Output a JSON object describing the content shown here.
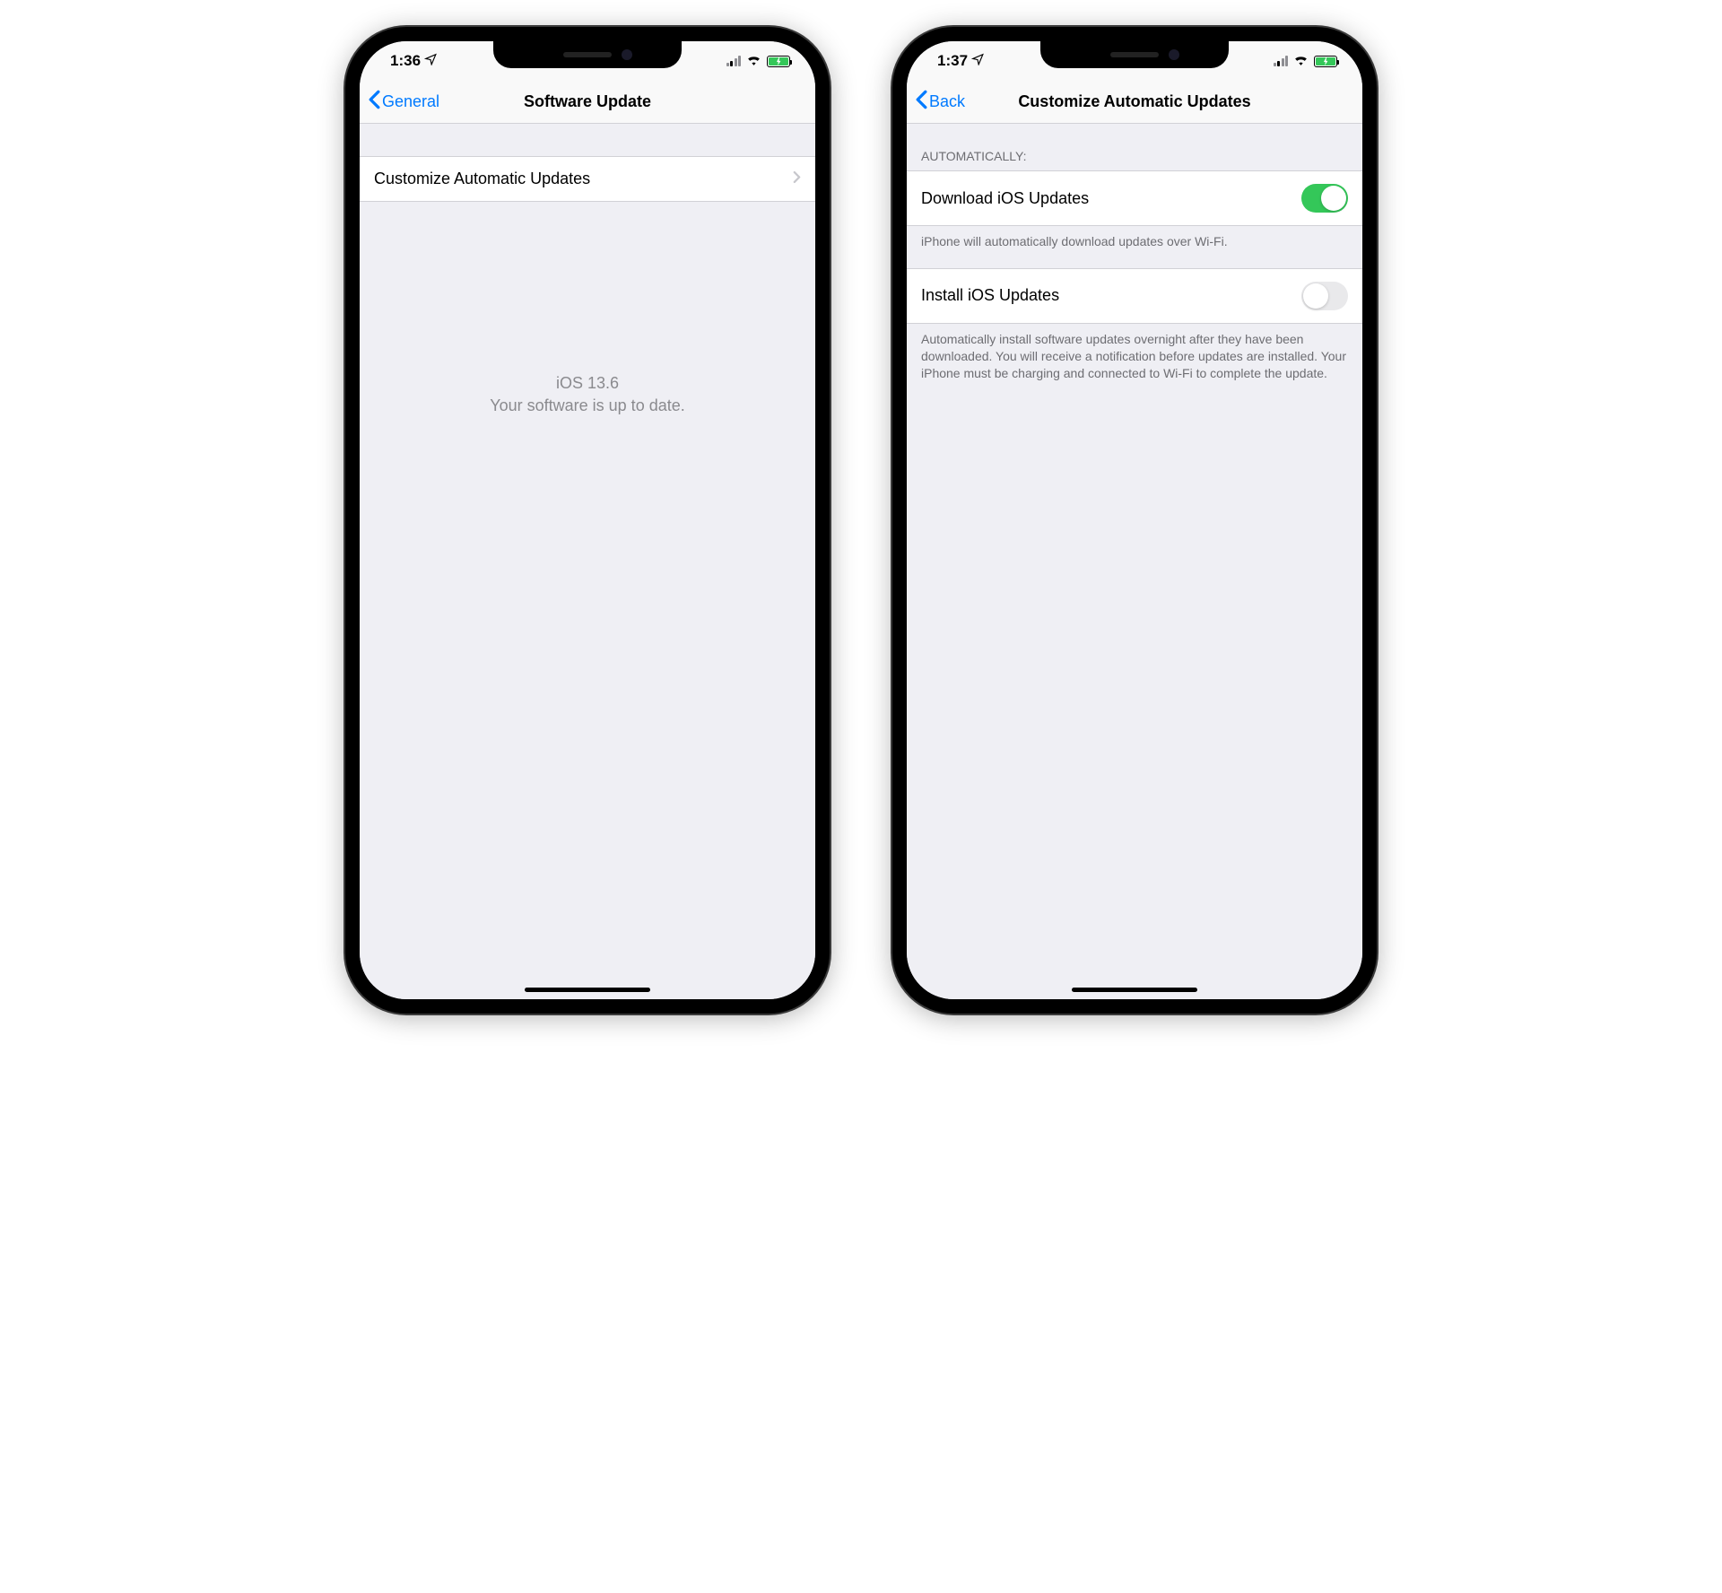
{
  "left": {
    "status": {
      "time": "1:36"
    },
    "nav": {
      "back": "General",
      "title": "Software Update"
    },
    "row": {
      "label": "Customize Automatic Updates"
    },
    "message": {
      "line1": "iOS 13.6",
      "line2": "Your software is up to date."
    }
  },
  "right": {
    "status": {
      "time": "1:37"
    },
    "nav": {
      "back": "Back",
      "title": "Customize Automatic Updates"
    },
    "section_header": "Automatically:",
    "rows": [
      {
        "label": "Download iOS Updates",
        "on": true
      },
      {
        "label": "Install iOS Updates",
        "on": false
      }
    ],
    "footers": [
      "iPhone will automatically download updates over Wi-Fi.",
      "Automatically install software updates overnight after they have been downloaded. You will receive a notification before updates are installed. Your iPhone must be charging and connected to Wi-Fi to complete the update."
    ]
  }
}
